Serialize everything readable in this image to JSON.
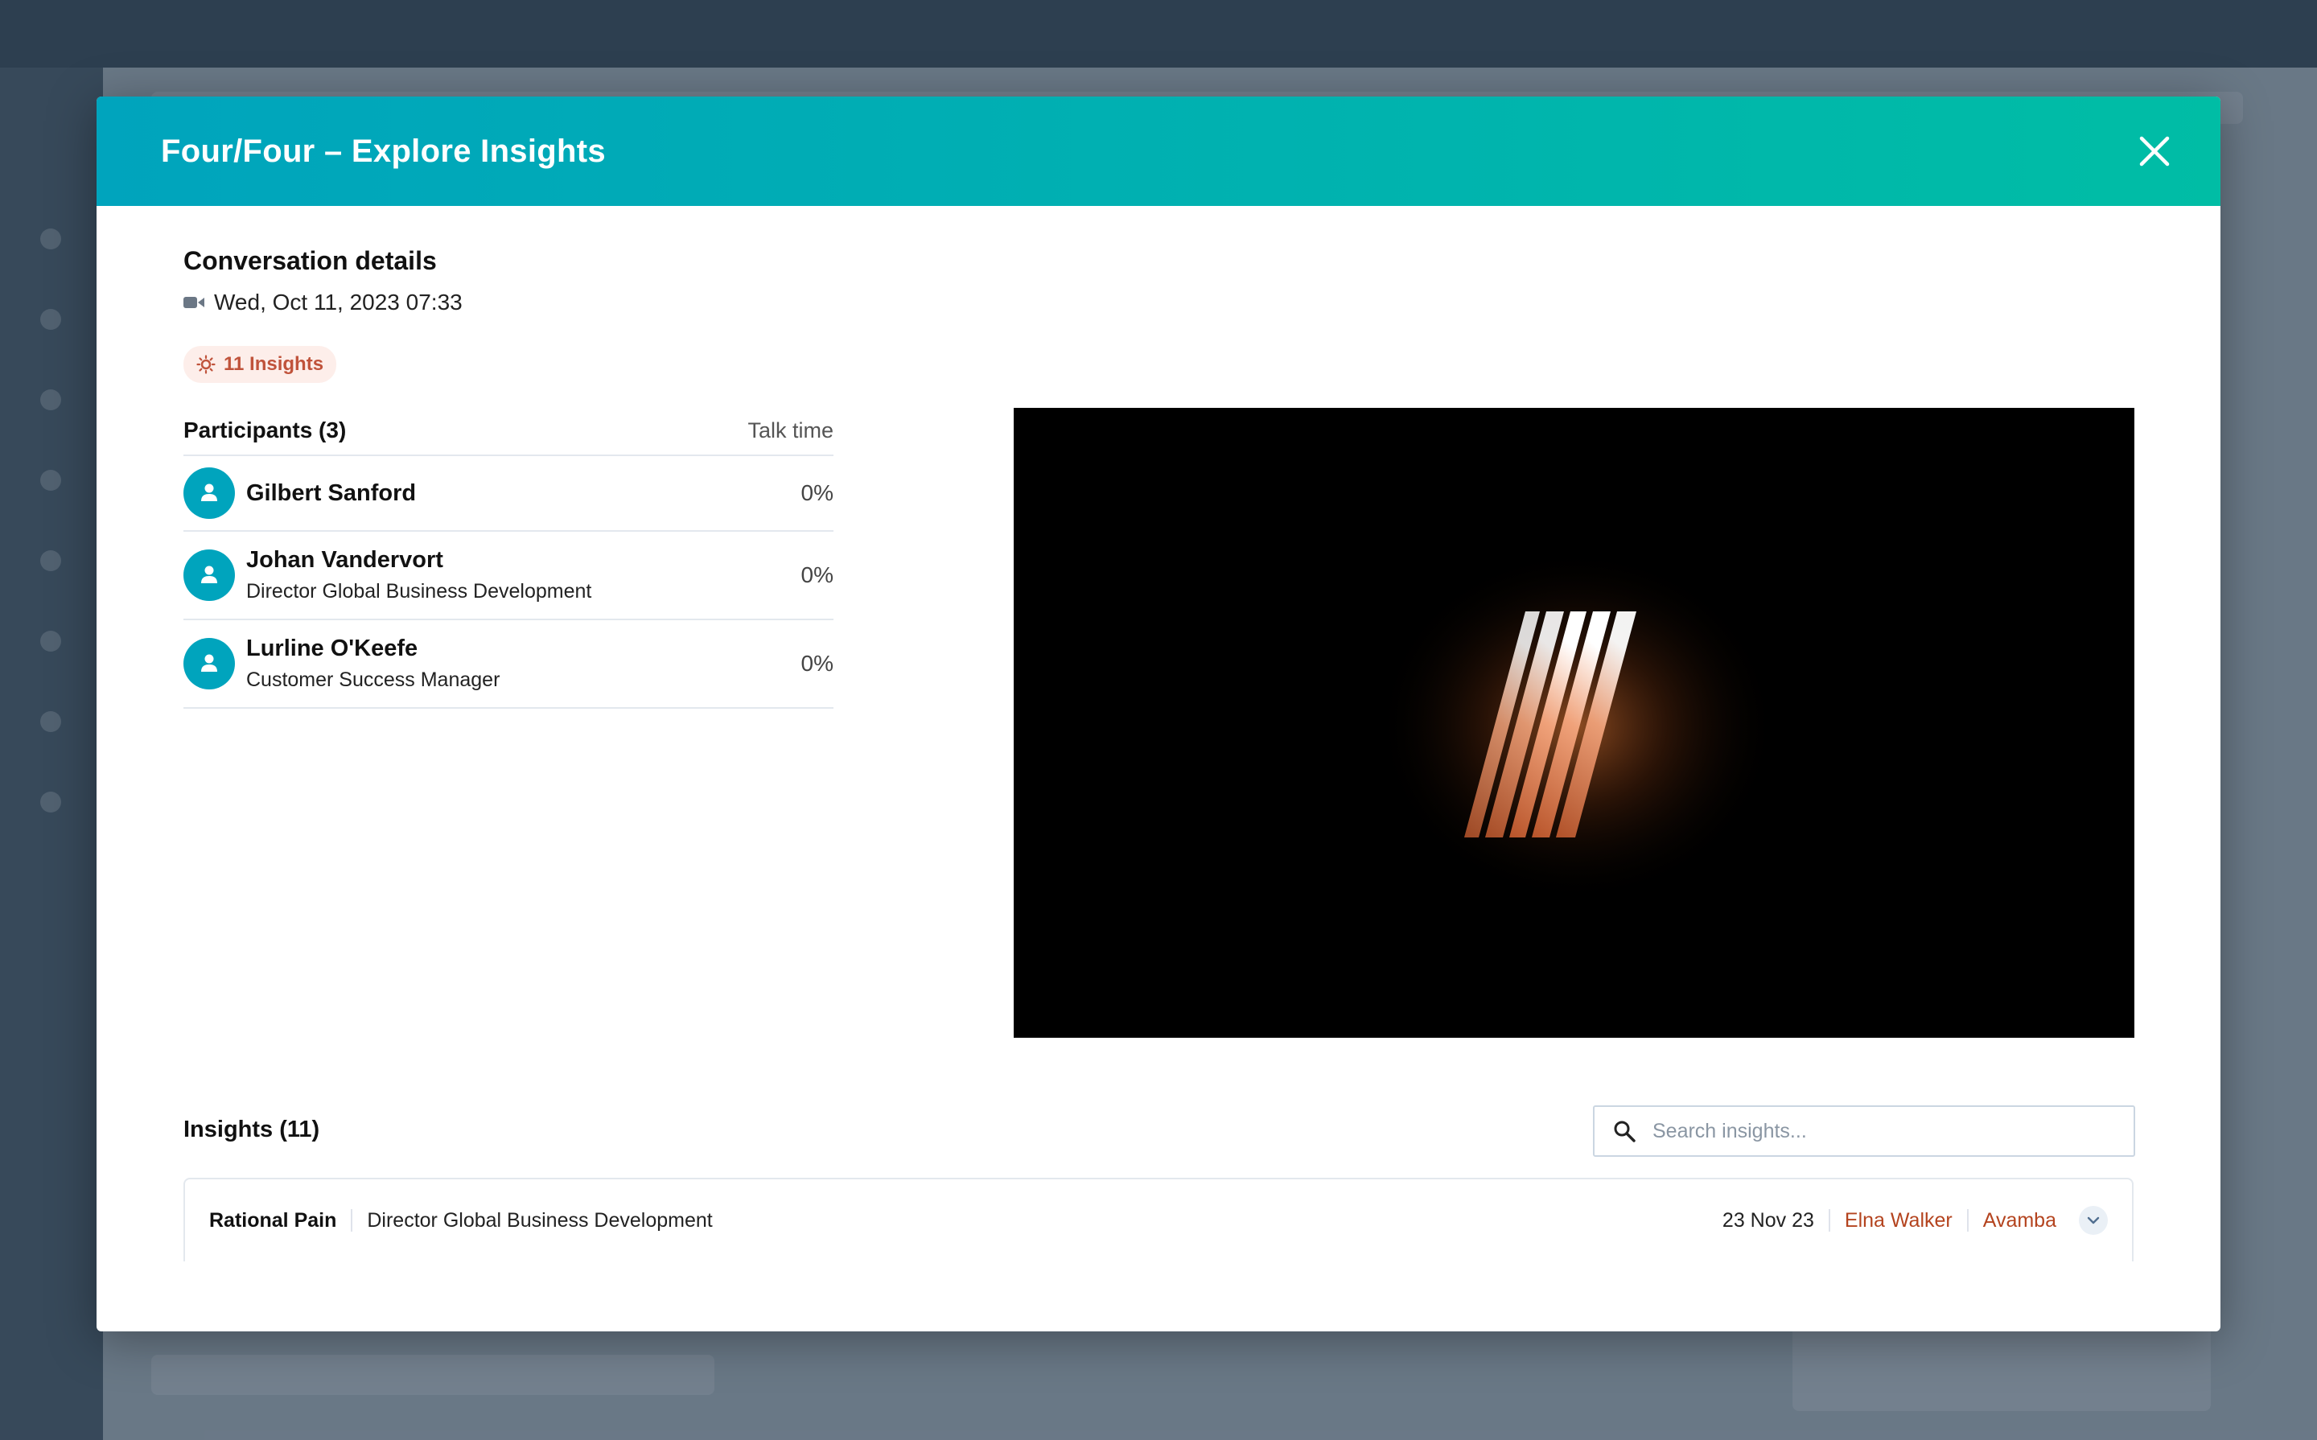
{
  "modal": {
    "title": "Four/Four – Explore Insights",
    "close_icon": "close-icon"
  },
  "conversation": {
    "section_title": "Conversation details",
    "date": "Wed, Oct 11, 2023 07:33",
    "camera_icon": "video-camera-icon",
    "insights_badge": "11 Insights"
  },
  "participants": {
    "title": "Participants (3)",
    "talk_time_label": "Talk time",
    "items": [
      {
        "name": "Gilbert Sanford",
        "role": "",
        "talk_time": "0%"
      },
      {
        "name": "Johan Vandervort",
        "role": "Director Global Business Development",
        "talk_time": "0%"
      },
      {
        "name": "Lurline O'Keefe",
        "role": "Customer Success Manager",
        "talk_time": "0%"
      }
    ]
  },
  "insights": {
    "title": "Insights (11)",
    "search_placeholder": "Search insights...",
    "items": [
      {
        "type": "Rational Pain",
        "role": "Director Global Business Development",
        "date": "23 Nov 23",
        "owner": "Elna Walker",
        "company": "Avamba"
      }
    ]
  },
  "colors": {
    "header_gradient_start": "#00a4bd",
    "header_gradient_end": "#00bda5",
    "badge_text": "#c0533b",
    "link": "#b4441f",
    "avatar": "#00a4bd"
  }
}
